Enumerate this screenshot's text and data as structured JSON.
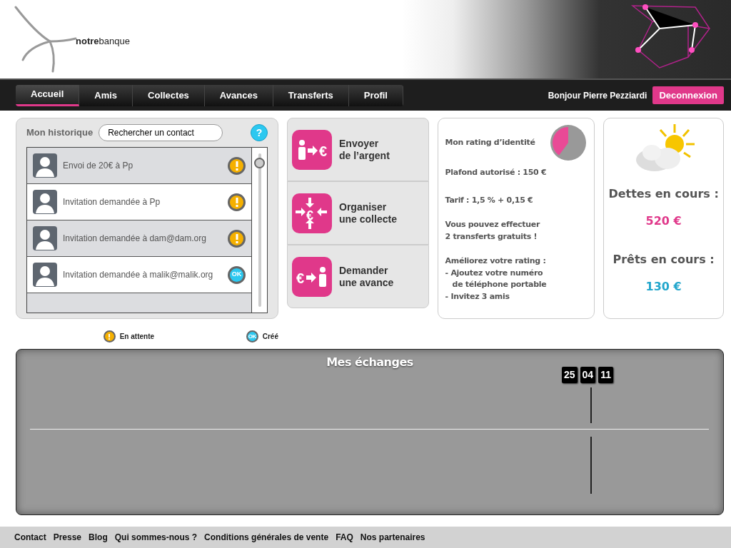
{
  "header": {
    "logo": "**notre**banque"
  },
  "nav": {
    "tabs": [
      {
        "label": "Accueil",
        "selected": true
      },
      {
        "label": "Amis",
        "selected": false
      },
      {
        "label": "Collectes",
        "selected": false
      },
      {
        "label": "Avances",
        "selected": false
      },
      {
        "label": "Transferts",
        "selected": false
      },
      {
        "label": "Profil",
        "selected": false
      }
    ],
    "greeting": "Bonjour Pierre Pezziardi",
    "logout": "Deconnexion"
  },
  "history": {
    "title": "Mon historique",
    "search": {
      "placeholder": "Rechercher un contact"
    },
    "help": "?",
    "items": [
      {
        "text": "Envoi de 20€ à Pp",
        "kind": "pending"
      },
      {
        "text": "Invitation demandée à Pp",
        "kind": "pending"
      },
      {
        "text": "Invitation demandée à dam@dam.org",
        "kind": "pending"
      },
      {
        "text": "Invitation demandée à malik@malik.org",
        "kind": "ok",
        "badge": "OK"
      }
    ],
    "legend": [
      {
        "kind": "pending",
        "label": "En attente"
      },
      {
        "kind": "ok",
        "label": "Créé",
        "badge": "OK"
      }
    ]
  },
  "actions": [
    {
      "kind": "send",
      "symbol": "€",
      "label": [
        "Envoyer",
        "de l’argent"
      ]
    },
    {
      "kind": "collect",
      "symbol": "€",
      "label": [
        "Organiser",
        "une collecte"
      ]
    },
    {
      "kind": "advance",
      "symbol": "€",
      "label": [
        "Demander",
        "une avance"
      ]
    }
  ],
  "rating": {
    "title": "Mon rating d’identité",
    "level": 0.4,
    "ceiling": "Plafond autorisé : 150 €",
    "fee": "Tarif : 1,5 % + 0,15 €",
    "free_transfers": [
      "Vous pouvez effectuer",
      "**2** transferts gratuits !"
    ],
    "improve": [
      "Améliorez votre rating :",
      "- Ajoutez votre numéro",
      "de téléphone  portable",
      "- Invitez 3 amis"
    ]
  },
  "balance": {
    "debts_label": "Dettes en cours :",
    "debts": "520 €",
    "loans_label": "Prêts en cours :",
    "loans": "130 €"
  },
  "exchanges": {
    "title": "Mes échanges",
    "date": [
      "25",
      "04",
      "11"
    ]
  },
  "footer": [
    "Contact",
    "Presse",
    "Blog",
    "Qui sommes-nous ?",
    "Conditions générales de vente",
    "FAQ",
    "Nos partenaires"
  ]
}
